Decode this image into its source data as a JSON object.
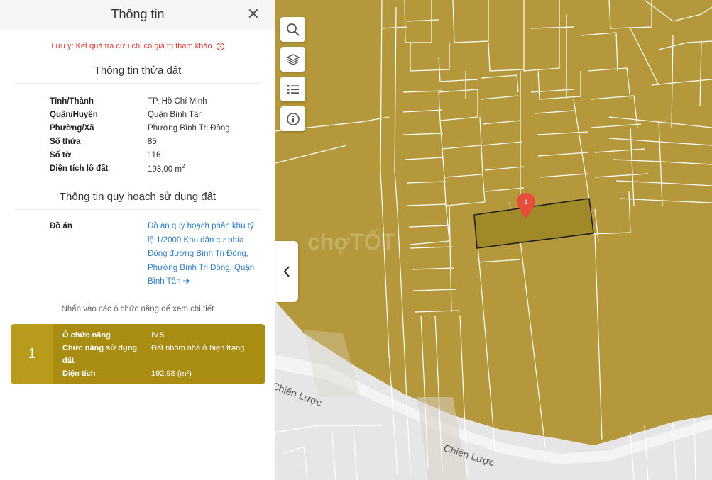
{
  "panel": {
    "title": "Thông tin",
    "warning": "Lưu ý: Kết quả tra cứu chỉ có giá trị tham khảo.",
    "parcel_section_title": "Thông tin thửa đất",
    "parcel": [
      {
        "label": "Tỉnh/Thành",
        "value": "TP. Hồ Chí Minh"
      },
      {
        "label": "Quận/Huyện",
        "value": "Quận Bình Tân"
      },
      {
        "label": "Phường/Xã",
        "value": "Phường Bình Trị Đông"
      },
      {
        "label": "Số thửa",
        "value": "85"
      },
      {
        "label": "Số tờ",
        "value": "116"
      },
      {
        "label": "Diện tích lô đất",
        "value": "193,00 m",
        "superscript": "2"
      }
    ],
    "planning_section_title": "Thông tin quy hoạch sử dụng đất",
    "plan_label": "Đồ án",
    "plan_link": "Đồ án quy hoạch phân khu tỷ lệ 1/2000 Khu dân cư phía Đông đường Bình Trị Đông, Phường Bình Trị Đông, Quận Bình Tân",
    "hint": "Nhấn vào các ô chức năng để xem chi tiết",
    "function_card": {
      "number": "1",
      "rows": [
        {
          "label": "Ô chức năng",
          "value": "IV.5"
        },
        {
          "label": "Chức năng sử dụng đất",
          "value": "Đất nhóm nhà ở hiện trạng"
        },
        {
          "label": "Diện tích",
          "value": "192,98 (m²)"
        }
      ]
    }
  },
  "map": {
    "road_label_1": "Chiến Lược",
    "road_label_2": "Chiến Lược",
    "marker_label": "1",
    "watermark": "chợTỐT",
    "colors": {
      "land": "#b5983b",
      "road": "#e6e6e6",
      "parcel_line": "#ffffff",
      "selected_outline": "#1f1f1f",
      "marker": "#e84c3d",
      "card": "#a98d13"
    }
  },
  "tools": [
    "search-icon",
    "layers-icon",
    "list-icon",
    "info-icon"
  ]
}
